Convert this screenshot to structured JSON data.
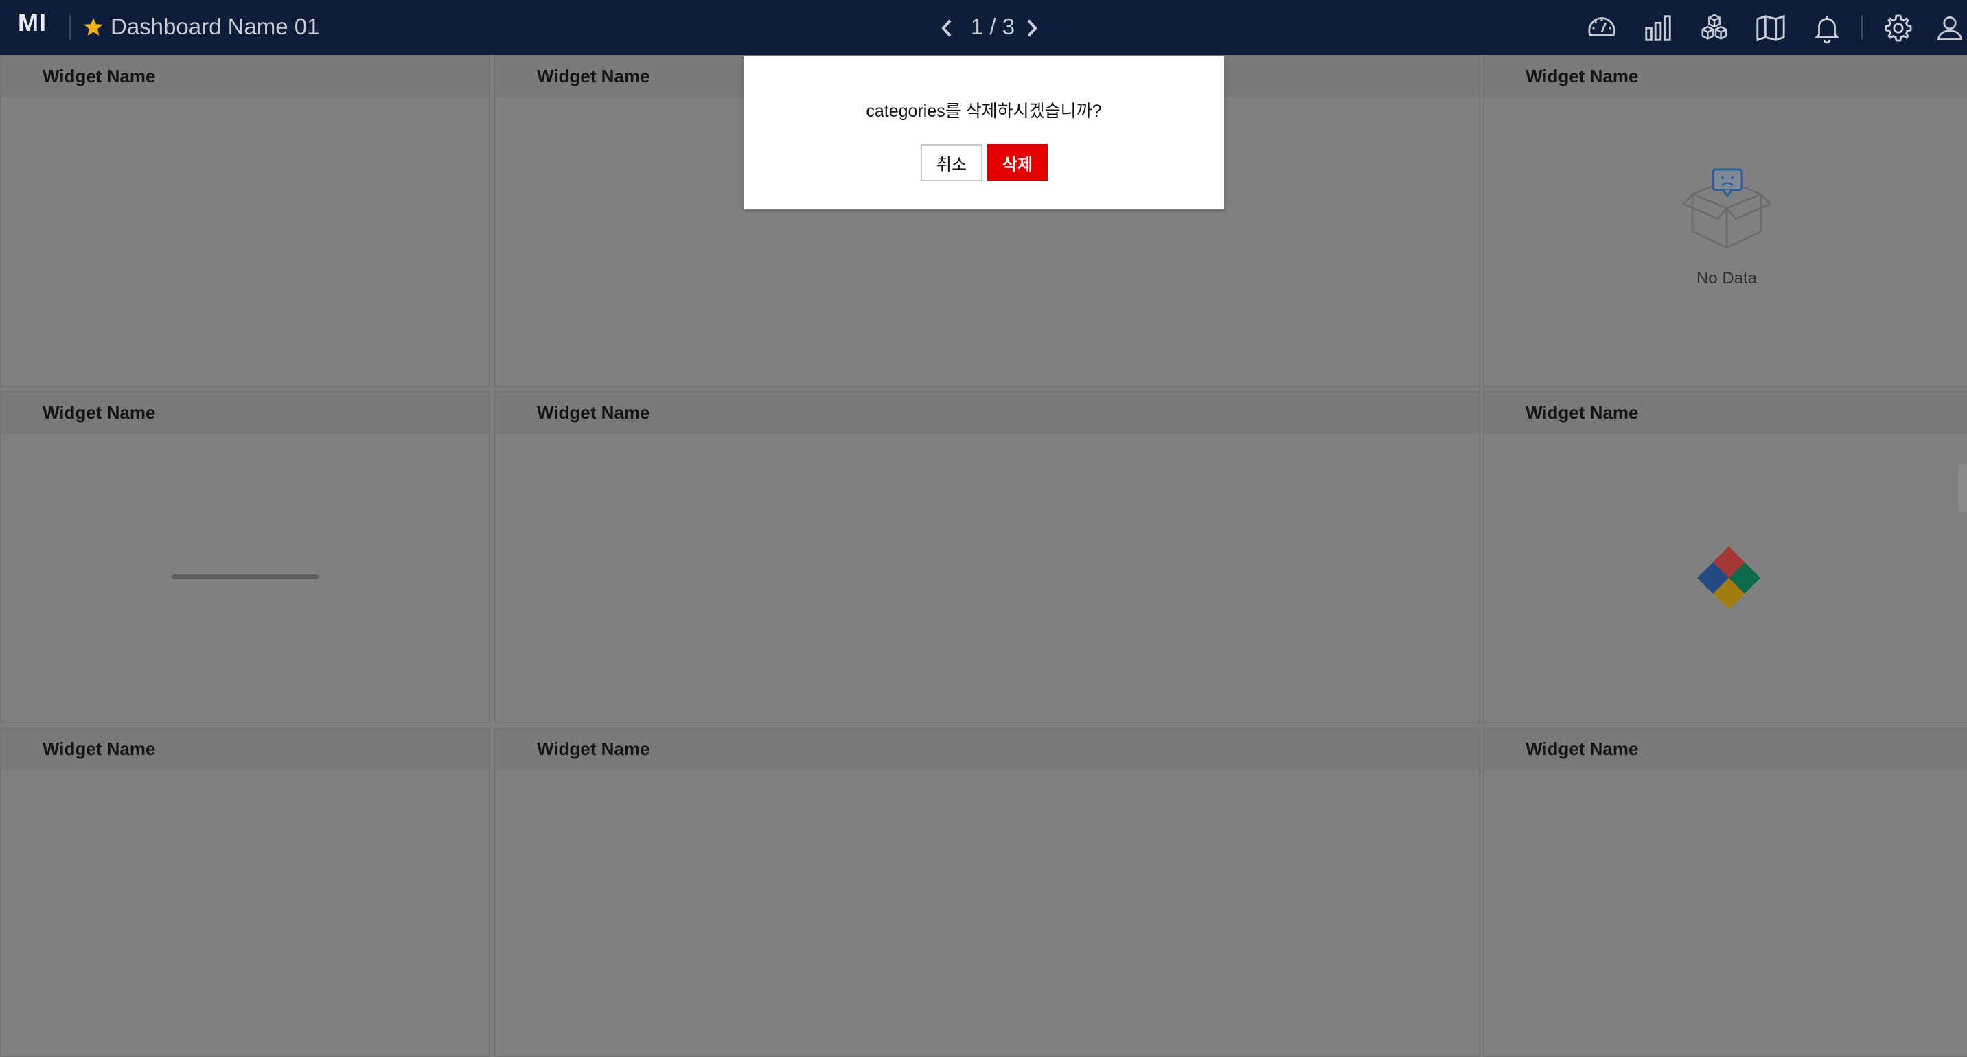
{
  "app": {
    "logo": "MI",
    "dashboard_title": "Dashboard Name 01",
    "favorite_icon": "star-icon",
    "accent_star_color": "#f0b417"
  },
  "pager": {
    "text": "1 / 3",
    "prev_icon": "chevron-left-icon",
    "next_icon": "chevron-right-icon"
  },
  "toolbar_icons": [
    "speedometer-icon",
    "bar-chart-icon",
    "cubes-icon",
    "map-icon",
    "bell-icon",
    "gear-icon",
    "user-icon"
  ],
  "widgets": [
    {
      "title": "Widget Name",
      "state": "empty"
    },
    {
      "title": "Widget Name",
      "state": "empty"
    },
    {
      "title": "Widget Name",
      "state": "no-data"
    },
    {
      "title": "Widget Name",
      "state": "loading-bar"
    },
    {
      "title": "Widget Name",
      "state": "empty"
    },
    {
      "title": "Widget Name",
      "state": "loading-spinner"
    },
    {
      "title": "Widget Name",
      "state": "empty"
    },
    {
      "title": "Widget Name",
      "state": "empty"
    },
    {
      "title": "Widget Name",
      "state": "empty"
    }
  ],
  "no_data": {
    "text": "No Data",
    "icon": "empty-box-icon"
  },
  "modal": {
    "message": "categories를 삭제하시겠습니까?",
    "cancel_label": "취소",
    "delete_label": "삭제",
    "delete_color": "#e50000"
  },
  "colors": {
    "topbar": "#0d1d3a",
    "overlay_background": "#7f7f7f",
    "spinner": [
      "#d64541",
      "#0f8a5f",
      "#d4a017",
      "#2f5fa8"
    ]
  }
}
